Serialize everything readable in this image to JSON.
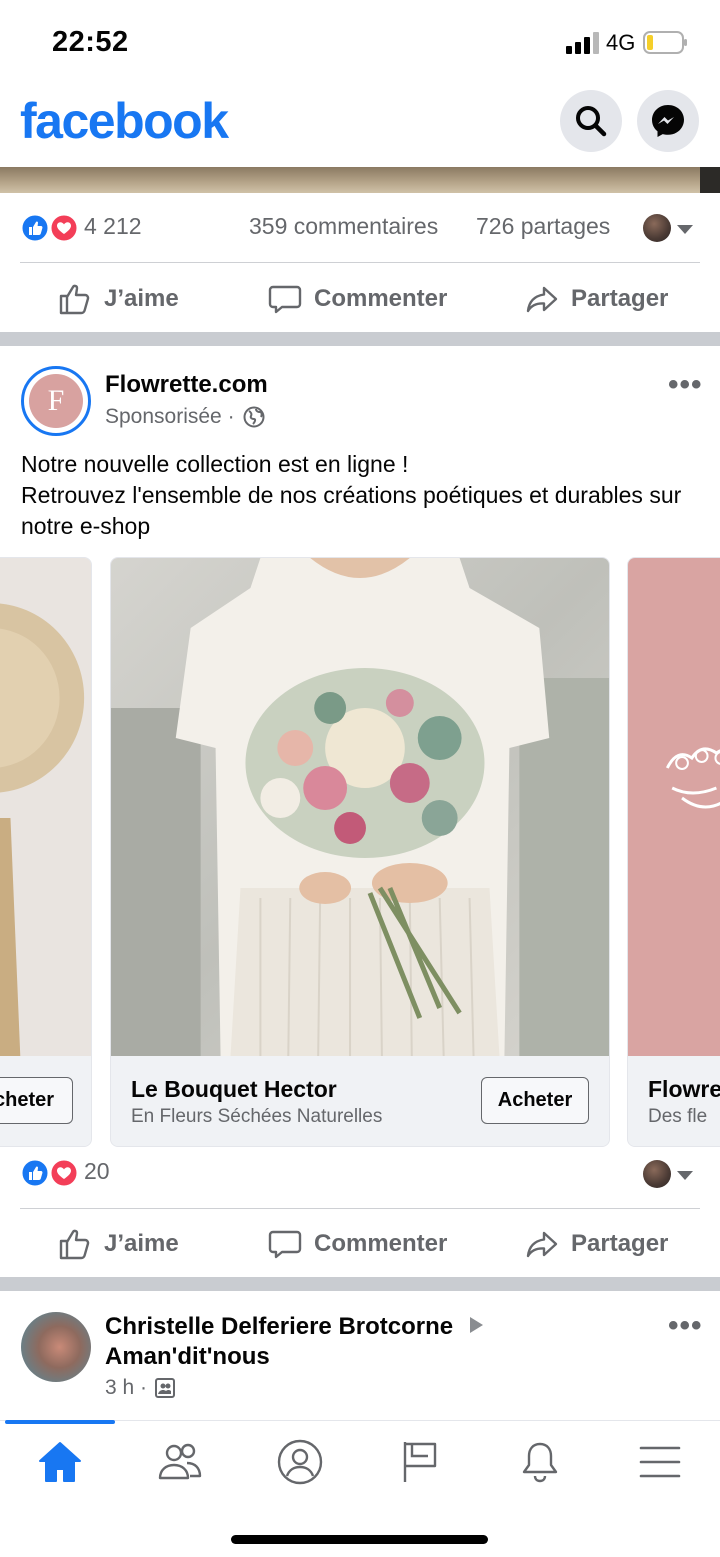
{
  "status_bar": {
    "time": "22:52",
    "network": "4G",
    "battery_level": 0.2
  },
  "header": {
    "logo": "facebook",
    "search_icon": "search-icon",
    "messenger_icon": "messenger-icon"
  },
  "previous_post": {
    "reaction_count": "4 212",
    "comments": "359 commentaires",
    "shares": "726 partages"
  },
  "actions": {
    "like": "J’aime",
    "comment": "Commenter",
    "share": "Partager"
  },
  "sponsored_post": {
    "page_name": "Flowrette.com",
    "avatar_letter": "F",
    "meta": "Sponsorisée ·",
    "text": "Notre nouvelle collection est en ligne !\nRetrouvez l'ensemble de nos créations poétiques et durables sur notre e-shop",
    "cards": [
      {
        "title": "",
        "subtitle": "",
        "button": "cheter"
      },
      {
        "title": "Le Bouquet Hector",
        "subtitle": "En Fleurs Séchées Naturelles",
        "button": "Acheter"
      },
      {
        "title": "Flowre",
        "subtitle": "Des fle",
        "button": ""
      }
    ],
    "reaction_count": "20"
  },
  "next_post": {
    "author": "Christelle Delferiere Brotcorne",
    "group": "Aman'dit'nous",
    "time": "3 h ·"
  },
  "bottom_nav": [
    "home-icon",
    "friends-icon",
    "profile-icon",
    "pages-flag-icon",
    "bell-icon",
    "menu-icon"
  ],
  "colors": {
    "brand": "#1877f2",
    "secondary_text": "#65676b",
    "separator": "#c9ccd1",
    "love": "#f33e58"
  }
}
